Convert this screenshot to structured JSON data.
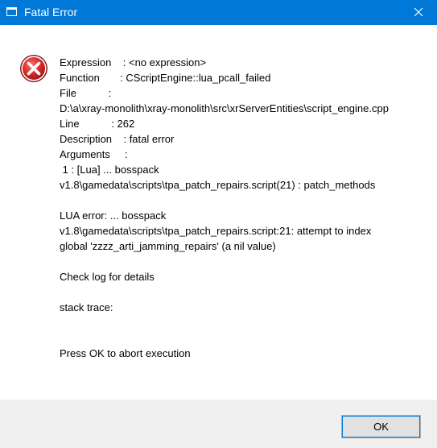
{
  "window": {
    "title": "Fatal Error"
  },
  "message": {
    "expression": "Expression    : <no expression>",
    "function": "Function       : CScriptEngine::lua_pcall_failed",
    "file_label": "File           :",
    "file_path": "D:\\a\\xray-monolith\\xray-monolith\\src\\xrServerEntities\\script_engine.cpp",
    "line": "Line           : 262",
    "description": "Description    : fatal error",
    "arguments": "Arguments     :",
    "arg1_line1": " 1 : [Lua] ... bosspack",
    "arg1_line2": "v1.8\\gamedata\\scripts\\tpa_patch_repairs.script(21) : patch_methods",
    "lua_error_line1": "LUA error: ... bosspack",
    "lua_error_line2": "v1.8\\gamedata\\scripts\\tpa_patch_repairs.script:21: attempt to index",
    "lua_error_line3": "global 'zzzz_arti_jamming_repairs' (a nil value)",
    "check_log": "Check log for details",
    "stack_trace": "stack trace:",
    "press_ok": "Press OK to abort execution"
  },
  "buttons": {
    "ok_label": "OK"
  },
  "icons": {
    "app": "window-icon",
    "close": "close-icon",
    "error": "error-icon"
  },
  "colors": {
    "titlebar": "#0078d7",
    "error_red": "#e81123",
    "footer": "#f0f0f0"
  }
}
